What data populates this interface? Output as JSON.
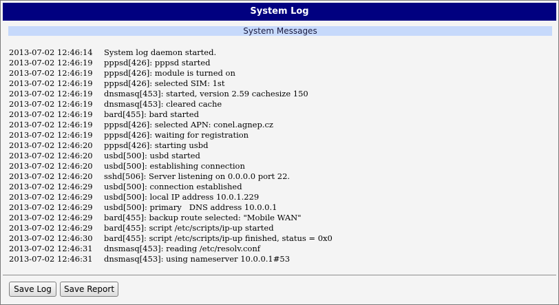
{
  "window": {
    "title": "System Log"
  },
  "section": {
    "title": "System Messages"
  },
  "log": [
    {
      "timestamp": "2013-07-02 12:46:14",
      "message": "System log daemon started."
    },
    {
      "timestamp": "2013-07-02 12:46:19",
      "message": "pppsd[426]: pppsd started"
    },
    {
      "timestamp": "2013-07-02 12:46:19",
      "message": "pppsd[426]: module is turned on"
    },
    {
      "timestamp": "2013-07-02 12:46:19",
      "message": "pppsd[426]: selected SIM: 1st"
    },
    {
      "timestamp": "2013-07-02 12:46:19",
      "message": "dnsmasq[453]: started, version 2.59 cachesize 150"
    },
    {
      "timestamp": "2013-07-02 12:46:19",
      "message": "dnsmasq[453]: cleared cache"
    },
    {
      "timestamp": "2013-07-02 12:46:19",
      "message": "bard[455]: bard started"
    },
    {
      "timestamp": "2013-07-02 12:46:19",
      "message": "pppsd[426]: selected APN: conel.agnep.cz"
    },
    {
      "timestamp": "2013-07-02 12:46:19",
      "message": "pppsd[426]: waiting for registration"
    },
    {
      "timestamp": "2013-07-02 12:46:20",
      "message": "pppsd[426]: starting usbd"
    },
    {
      "timestamp": "2013-07-02 12:46:20",
      "message": "usbd[500]: usbd started"
    },
    {
      "timestamp": "2013-07-02 12:46:20",
      "message": "usbd[500]: establishing connection"
    },
    {
      "timestamp": "2013-07-02 12:46:20",
      "message": "sshd[506]: Server listening on 0.0.0.0 port 22."
    },
    {
      "timestamp": "2013-07-02 12:46:29",
      "message": "usbd[500]: connection established"
    },
    {
      "timestamp": "2013-07-02 12:46:29",
      "message": "usbd[500]: local IP address 10.0.1.229"
    },
    {
      "timestamp": "2013-07-02 12:46:29",
      "message": "usbd[500]: primary   DNS address 10.0.0.1"
    },
    {
      "timestamp": "2013-07-02 12:46:29",
      "message": "bard[455]: backup route selected: \"Mobile WAN\""
    },
    {
      "timestamp": "2013-07-02 12:46:29",
      "message": "bard[455]: script /etc/scripts/ip-up started"
    },
    {
      "timestamp": "2013-07-02 12:46:30",
      "message": "bard[455]: script /etc/scripts/ip-up finished, status = 0x0"
    },
    {
      "timestamp": "2013-07-02 12:46:31",
      "message": "dnsmasq[453]: reading /etc/resolv.conf"
    },
    {
      "timestamp": "2013-07-02 12:46:31",
      "message": "dnsmasq[453]: using nameserver 10.0.0.1#53"
    }
  ],
  "buttons": {
    "save_log": "Save Log",
    "save_report": "Save Report"
  },
  "colors": {
    "title_bar": "#010080",
    "section_header": "#c6d9fb",
    "background": "#f4f4f4"
  }
}
